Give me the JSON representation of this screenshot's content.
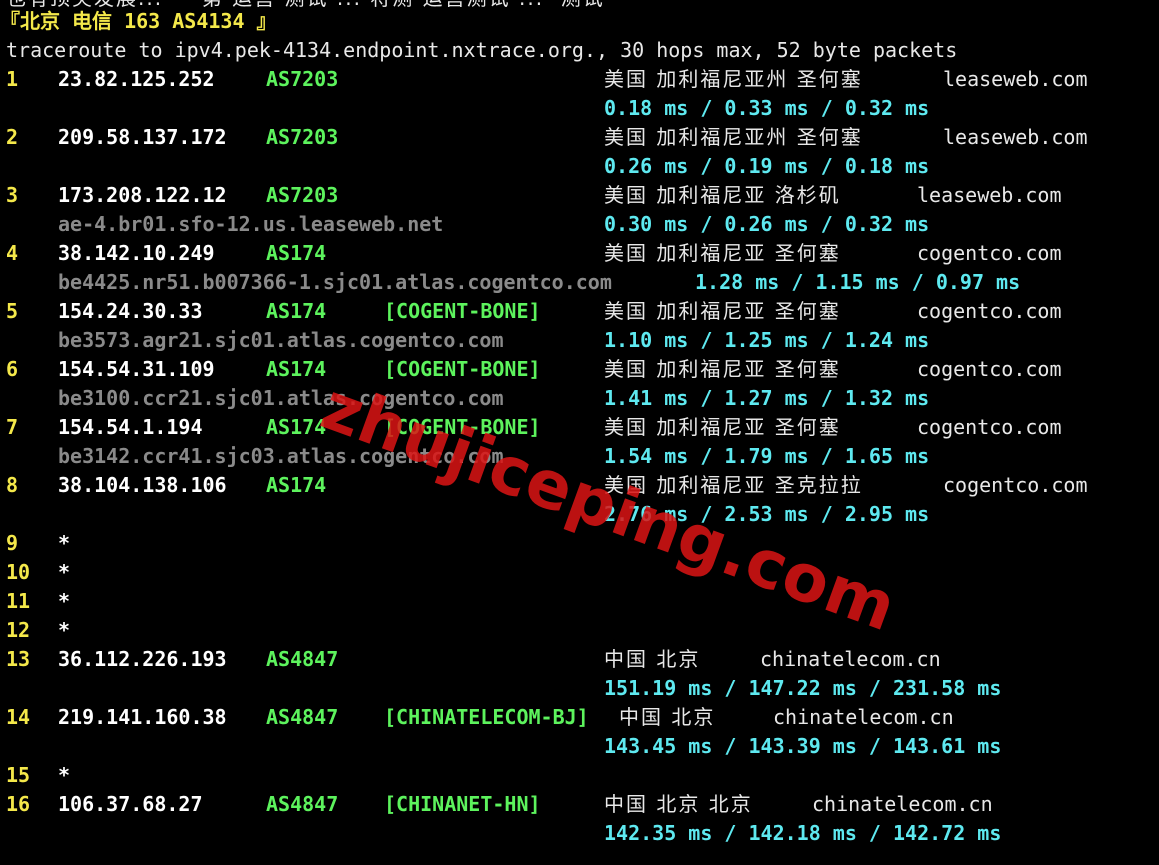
{
  "header": {
    "cut_line": "也有顶尖发展... 一 第 运营 测试 ... 将测 运营测试 ...  测试",
    "target_label": "『北京 电信 163 AS4134 』",
    "traceroute_line": "traceroute to ipv4.pek-4134.endpoint.nxtrace.org., 30 hops max, 52 byte packets"
  },
  "hops": [
    {
      "num": "1",
      "ip": "23.82.125.252",
      "asn": "AS7203",
      "tag": "",
      "geo": "美国 加利福尼亚州 圣何塞",
      "domain": "leaseweb.com",
      "rdns": "",
      "rtt": "0.18 ms / 0.33 ms / 0.32 ms"
    },
    {
      "num": "2",
      "ip": "209.58.137.172",
      "asn": "AS7203",
      "tag": "",
      "geo": "美国 加利福尼亚州 圣何塞",
      "domain": "leaseweb.com",
      "rdns": "",
      "rtt": "0.26 ms / 0.19 ms / 0.18 ms"
    },
    {
      "num": "3",
      "ip": "173.208.122.12",
      "asn": "AS7203",
      "tag": "",
      "geo": "美国 加利福尼亚 洛杉矶",
      "domain": "leaseweb.com",
      "rdns": "ae-4.br01.sfo-12.us.leaseweb.net",
      "rtt": "0.30 ms / 0.26 ms / 0.32 ms"
    },
    {
      "num": "4",
      "ip": "38.142.10.249",
      "asn": "AS174",
      "tag": "",
      "geo": "美国 加利福尼亚 圣何塞",
      "domain": "cogentco.com",
      "rdns": "be4425.nr51.b007366-1.sjc01.atlas.cogentco.com",
      "rtt": "1.28 ms / 1.15 ms / 0.97 ms"
    },
    {
      "num": "5",
      "ip": "154.24.30.33",
      "asn": "AS174",
      "tag": "[COGENT-BONE]",
      "geo": "美国 加利福尼亚 圣何塞",
      "domain": "cogentco.com",
      "rdns": "be3573.agr21.sjc01.atlas.cogentco.com",
      "rtt": "1.10 ms / 1.25 ms / 1.24 ms"
    },
    {
      "num": "6",
      "ip": "154.54.31.109",
      "asn": "AS174",
      "tag": "[COGENT-BONE]",
      "geo": "美国 加利福尼亚 圣何塞",
      "domain": "cogentco.com",
      "rdns": "be3100.ccr21.sjc01.atlas.cogentco.com",
      "rtt": "1.41 ms / 1.27 ms / 1.32 ms"
    },
    {
      "num": "7",
      "ip": "154.54.1.194",
      "asn": "AS174",
      "tag": "[COGENT-BONE]",
      "geo": "美国 加利福尼亚 圣何塞",
      "domain": "cogentco.com",
      "rdns": "be3142.ccr41.sjc03.atlas.cogentco.com",
      "rtt": "1.54 ms / 1.79 ms / 1.65 ms"
    },
    {
      "num": "8",
      "ip": "38.104.138.106",
      "asn": "AS174",
      "tag": "",
      "geo": "美国 加利福尼亚 圣克拉拉",
      "domain": "cogentco.com",
      "rdns": "",
      "rtt": "2.76 ms / 2.53 ms / 2.95 ms"
    },
    {
      "num": "9",
      "ip": "*",
      "asn": "",
      "tag": "",
      "geo": "",
      "domain": "",
      "rdns": "",
      "rtt": ""
    },
    {
      "num": "10",
      "ip": "*",
      "asn": "",
      "tag": "",
      "geo": "",
      "domain": "",
      "rdns": "",
      "rtt": ""
    },
    {
      "num": "11",
      "ip": "*",
      "asn": "",
      "tag": "",
      "geo": "",
      "domain": "",
      "rdns": "",
      "rtt": ""
    },
    {
      "num": "12",
      "ip": "*",
      "asn": "",
      "tag": "",
      "geo": "",
      "domain": "",
      "rdns": "",
      "rtt": ""
    },
    {
      "num": "13",
      "ip": "36.112.226.193",
      "asn": "AS4847",
      "tag": "",
      "geo": "中国 北京",
      "domain": "chinatelecom.cn",
      "rdns": "",
      "rtt": "151.19 ms / 147.22 ms / 231.58 ms"
    },
    {
      "num": "14",
      "ip": "219.141.160.38",
      "asn": "AS4847",
      "tag": "[CHINATELECOM-BJ]",
      "geo": "中国 北京",
      "domain": "chinatelecom.cn",
      "rdns": "",
      "rtt": "143.45 ms / 143.39 ms / 143.61 ms"
    },
    {
      "num": "15",
      "ip": "*",
      "asn": "",
      "tag": "",
      "geo": "",
      "domain": "",
      "rdns": "",
      "rtt": ""
    },
    {
      "num": "16",
      "ip": "106.37.68.27",
      "asn": "AS4847",
      "tag": "[CHINANET-HN]",
      "geo": "中国 北京 北京",
      "domain": "chinatelecom.cn",
      "rdns": "",
      "rtt": "142.35 ms / 142.18 ms / 142.72 ms"
    }
  ],
  "watermark": "zhujiceping.com",
  "colors": {
    "background": "#000000",
    "hop_number": "#f4e84a",
    "asn": "#5df35d",
    "rtt": "#5ee9f0",
    "rdns": "#8a8a8a",
    "watermark": "#dc1414"
  }
}
